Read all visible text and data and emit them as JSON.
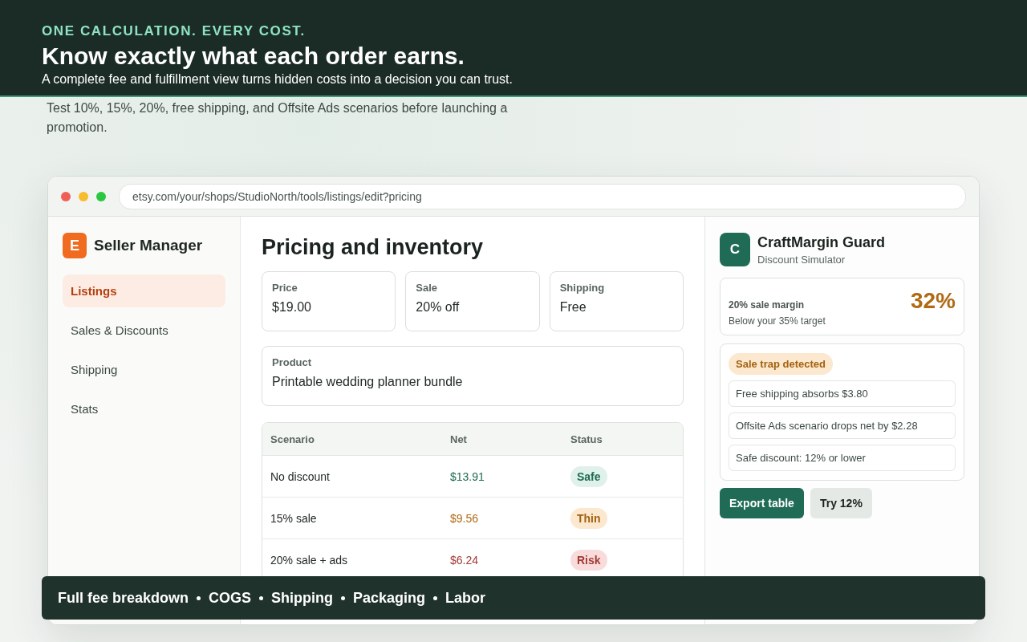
{
  "hero": {
    "eyebrow": "ONE CALCULATION. EVERY COST.",
    "title": "Know exactly what each order earns.",
    "subtitle": "A complete fee and fulfillment view turns hidden costs into a decision you can trust."
  },
  "intro": "Test 10%, 15%, 20%, free shipping, and Offsite Ads scenarios before launching a promotion.",
  "browser": {
    "url": "etsy.com/your/shops/StudioNorth/tools/listings/edit?pricing"
  },
  "sidebar": {
    "logo": "E",
    "title": "Seller Manager",
    "items": [
      {
        "label": "Listings",
        "selected": true
      },
      {
        "label": "Sales & Discounts",
        "selected": false
      },
      {
        "label": "Shipping",
        "selected": false
      },
      {
        "label": "Stats",
        "selected": false
      }
    ]
  },
  "main": {
    "title": "Pricing and inventory",
    "fields": [
      {
        "label": "Price",
        "value": "$19.00"
      },
      {
        "label": "Sale",
        "value": "20% off"
      },
      {
        "label": "Shipping",
        "value": "Free"
      }
    ],
    "product": {
      "label": "Product",
      "value": "Printable wedding planner bundle"
    },
    "table": {
      "columns": [
        "Scenario",
        "Net",
        "Status"
      ],
      "rows": [
        {
          "scenario": "No discount",
          "net": "$13.91",
          "status": "Safe",
          "kind": "safe"
        },
        {
          "scenario": "15% sale",
          "net": "$9.56",
          "status": "Thin",
          "kind": "thin"
        },
        {
          "scenario": "20% sale + ads",
          "net": "$6.24",
          "status": "Risk",
          "kind": "risk"
        }
      ]
    }
  },
  "panel": {
    "logo": "C",
    "title": "CraftMargin Guard",
    "subtitle": "Discount Simulator",
    "margin": {
      "label": "20% sale margin",
      "note": "Below your 35% target",
      "value": "32%"
    },
    "alert": {
      "badge": "Sale trap detected",
      "items": [
        "Free shipping absorbs $3.80",
        "Offsite Ads scenario drops net by $2.28",
        "Safe discount: 12% or lower"
      ]
    },
    "buttons": [
      {
        "label": "Export table",
        "kind": "primary"
      },
      {
        "label": "Try 12%",
        "kind": "secondary"
      }
    ]
  },
  "banner": [
    "Full fee breakdown",
    "COGS",
    "Shipping",
    "Packaging",
    "Labor"
  ]
}
